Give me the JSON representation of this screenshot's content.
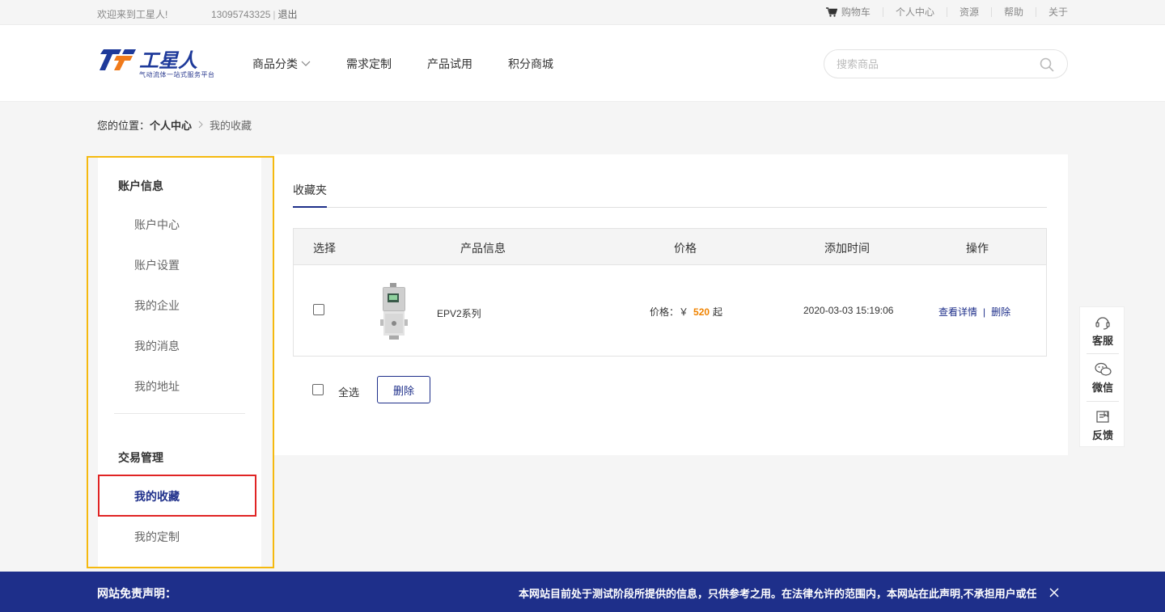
{
  "topbar": {
    "welcome": "欢迎来到工星人!",
    "phone": "13095743325",
    "separator": "|",
    "logout": "退出",
    "cart": "购物车",
    "user_center": "个人中心",
    "resources": "资源",
    "help": "帮助",
    "about": "关于"
  },
  "header": {
    "logo_text": "工星人",
    "logo_slogan": "气动流体一站式服务平台",
    "nav": {
      "categories": "商品分类",
      "custom": "需求定制",
      "trial": "产品试用",
      "points_mall": "积分商城"
    },
    "search_placeholder": "搜索商品"
  },
  "breadcrumb": {
    "prefix": "您的位置：",
    "parent": "个人中心",
    "arrow": ">",
    "current": "我的收藏"
  },
  "sidebar": {
    "account_title": "账户信息",
    "account_items": [
      "账户中心",
      "账户设置",
      "我的企业",
      "我的消息",
      "我的地址"
    ],
    "trade_title": "交易管理",
    "trade_items": [
      "我的收藏",
      "我的定制"
    ]
  },
  "main": {
    "tab": "收藏夹",
    "columns": {
      "select": "选择",
      "product": "产品信息",
      "price": "价格",
      "added": "添加时间",
      "ops": "操作"
    },
    "rows": [
      {
        "name": "EPV2系列",
        "price_label": "价格：￥",
        "price_value": "520",
        "price_suffix": "起",
        "added_time": "2020-03-03 15:19:06",
        "view": "查看详情",
        "sep": "|",
        "delete": "删除"
      }
    ],
    "select_all": "全选",
    "delete_button": "删除"
  },
  "float_bar": {
    "service": "客服",
    "wechat": "微信",
    "feedback": "反馈"
  },
  "disclaimer": {
    "title": "网站免责声明：",
    "text": "本网站目前处于测试阶段所提供的信息，只供参考之用。在法律允许的范围内，本网站在此声明,不承担用户或任"
  },
  "colors": {
    "brand_blue": "#1e2f8a",
    "price_orange": "#f08300",
    "highlight_yellow": "#f5b90f",
    "highlight_red": "#e02424"
  }
}
